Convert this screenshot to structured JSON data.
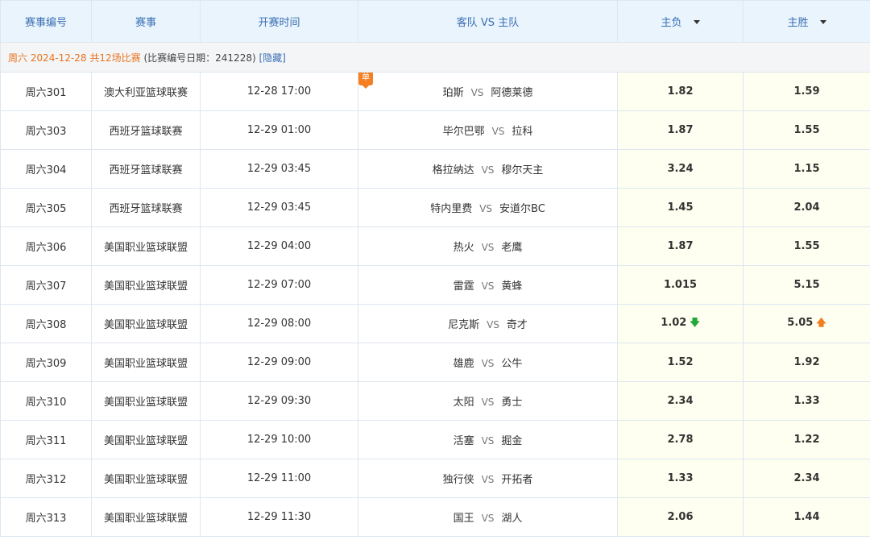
{
  "header": {
    "col_id": "赛事编号",
    "col_event": "赛事",
    "col_time": "开赛时间",
    "col_teams": "客队 VS 主队",
    "col_away_loss": "主负",
    "col_home_win": "主胜"
  },
  "date_row": {
    "highlight": "周六 2024-12-28 共12场比赛",
    "note": "(比赛编号日期：241228)",
    "hide_link": "[隐藏]"
  },
  "vs_text": "VS",
  "badge_text": "单",
  "colors": {
    "header_bg": "#e9f4fd",
    "header_text": "#3b6fb3",
    "odds_bg": "#fefff0",
    "highlight": "#e8731e",
    "arrow_down": "#22a83a",
    "arrow_up": "#f07d1f",
    "badge": "#f47e20"
  },
  "matches": [
    {
      "id": "周六301",
      "event": "澳大利亚篮球联赛",
      "time": "12-28 17:00",
      "away": "珀斯",
      "home": "阿德莱德",
      "away_loss": "1.82",
      "home_win": "1.59",
      "badge": true
    },
    {
      "id": "周六303",
      "event": "西班牙篮球联赛",
      "time": "12-29 01:00",
      "away": "毕尔巴鄂",
      "home": "拉科",
      "away_loss": "1.87",
      "home_win": "1.55"
    },
    {
      "id": "周六304",
      "event": "西班牙篮球联赛",
      "time": "12-29 03:45",
      "away": "格拉纳达",
      "home": "穆尔天主",
      "away_loss": "3.24",
      "home_win": "1.15"
    },
    {
      "id": "周六305",
      "event": "西班牙篮球联赛",
      "time": "12-29 03:45",
      "away": "特内里费",
      "home": "安道尔BC",
      "away_loss": "1.45",
      "home_win": "2.04"
    },
    {
      "id": "周六306",
      "event": "美国职业篮球联盟",
      "time": "12-29 04:00",
      "away": "热火",
      "home": "老鹰",
      "away_loss": "1.87",
      "home_win": "1.55"
    },
    {
      "id": "周六307",
      "event": "美国职业篮球联盟",
      "time": "12-29 07:00",
      "away": "雷霆",
      "home": "黄蜂",
      "away_loss": "1.015",
      "home_win": "5.15"
    },
    {
      "id": "周六308",
      "event": "美国职业篮球联盟",
      "time": "12-29 08:00",
      "away": "尼克斯",
      "home": "奇才",
      "away_loss": "1.02",
      "home_win": "5.05",
      "away_loss_trend": "down",
      "home_win_trend": "up"
    },
    {
      "id": "周六309",
      "event": "美国职业篮球联盟",
      "time": "12-29 09:00",
      "away": "雄鹿",
      "home": "公牛",
      "away_loss": "1.52",
      "home_win": "1.92"
    },
    {
      "id": "周六310",
      "event": "美国职业篮球联盟",
      "time": "12-29 09:30",
      "away": "太阳",
      "home": "勇士",
      "away_loss": "2.34",
      "home_win": "1.33"
    },
    {
      "id": "周六311",
      "event": "美国职业篮球联盟",
      "time": "12-29 10:00",
      "away": "活塞",
      "home": "掘金",
      "away_loss": "2.78",
      "home_win": "1.22"
    },
    {
      "id": "周六312",
      "event": "美国职业篮球联盟",
      "time": "12-29 11:00",
      "away": "独行侠",
      "home": "开拓者",
      "away_loss": "1.33",
      "home_win": "2.34"
    },
    {
      "id": "周六313",
      "event": "美国职业篮球联盟",
      "time": "12-29 11:30",
      "away": "国王",
      "home": "湖人",
      "away_loss": "2.06",
      "home_win": "1.44"
    }
  ]
}
